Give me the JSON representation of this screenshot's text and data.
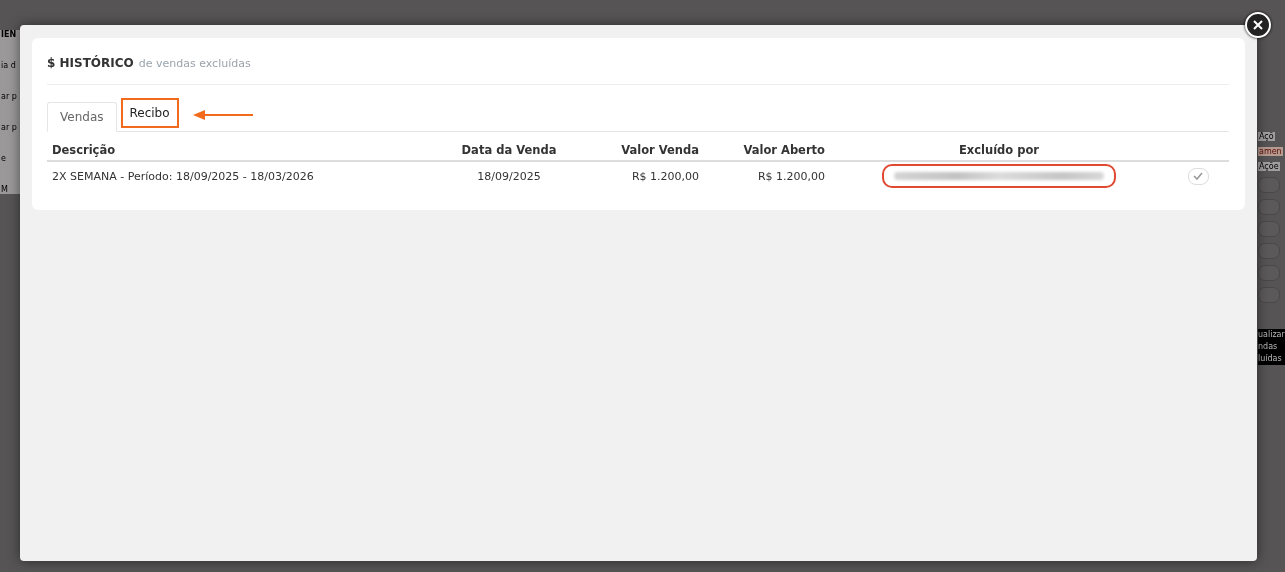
{
  "background": {
    "left_fragments": [
      "IEN",
      "ia d",
      "ar p",
      "ar p",
      "e",
      "M"
    ],
    "right_fragments": [
      {
        "text": "Açõ",
        "kind": "label"
      },
      {
        "text": "amen",
        "kind": "alert"
      },
      {
        "text": "Açõe",
        "kind": "label"
      }
    ],
    "tooltip": "ualizar ndas luídas"
  },
  "modal": {
    "title": "$ HISTÓRICO",
    "subtitle": "de vendas excluídas",
    "tabs": [
      {
        "label": "Vendas",
        "selected": true,
        "highlighted": false
      },
      {
        "label": "Recibo",
        "selected": false,
        "highlighted": true
      }
    ],
    "table": {
      "columns": [
        "Descrição",
        "Data da Venda",
        "Valor Venda",
        "Valor Aberto",
        "Excluído por"
      ],
      "rows": [
        {
          "description": "2X SEMANA - Período: 18/09/2025 - 18/03/2026",
          "date": "18/09/2025",
          "sale_value": "R$ 1.200,00",
          "open_value": "R$ 1.200,00",
          "deleted_by_redacted": true,
          "checked": true
        }
      ]
    }
  }
}
